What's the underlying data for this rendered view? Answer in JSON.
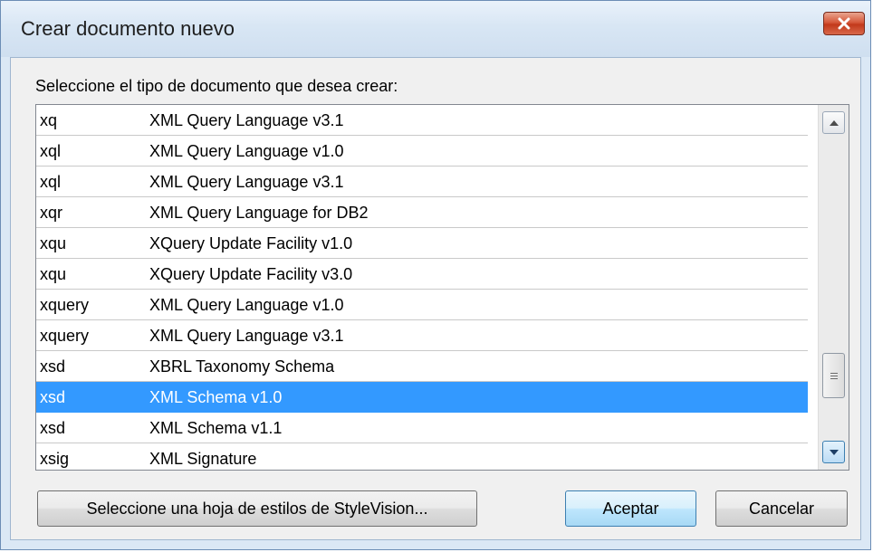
{
  "window": {
    "title": "Crear documento nuevo",
    "close_icon": "close-icon",
    "close_color": "#c2391b"
  },
  "prompt": "Seleccione el tipo de documento que desea crear:",
  "list": {
    "selected_index": 9,
    "selection_color": "#3399ff",
    "rows": [
      {
        "ext": "xq",
        "desc": "XML Query Language v3.1"
      },
      {
        "ext": "xql",
        "desc": "XML Query Language v1.0"
      },
      {
        "ext": "xql",
        "desc": "XML Query Language v3.1"
      },
      {
        "ext": "xqr",
        "desc": "XML Query Language for DB2"
      },
      {
        "ext": "xqu",
        "desc": "XQuery Update Facility v1.0"
      },
      {
        "ext": "xqu",
        "desc": "XQuery Update Facility v3.0"
      },
      {
        "ext": "xquery",
        "desc": "XML Query Language v1.0"
      },
      {
        "ext": "xquery",
        "desc": "XML Query Language v3.1"
      },
      {
        "ext": "xsd",
        "desc": "XBRL Taxonomy Schema"
      },
      {
        "ext": "xsd",
        "desc": "XML Schema v1.0"
      },
      {
        "ext": "xsd",
        "desc": "XML Schema v1.1"
      },
      {
        "ext": "xsig",
        "desc": "XML Signature"
      }
    ]
  },
  "scrollbar": {
    "up_icon": "scroll-up-arrow-icon",
    "down_icon": "scroll-down-arrow-icon",
    "thumb_icon": "grip-icon"
  },
  "buttons": {
    "stylesheet": "Seleccione una hoja de estilos de StyleVision...",
    "ok": "Aceptar",
    "cancel": "Cancelar"
  }
}
